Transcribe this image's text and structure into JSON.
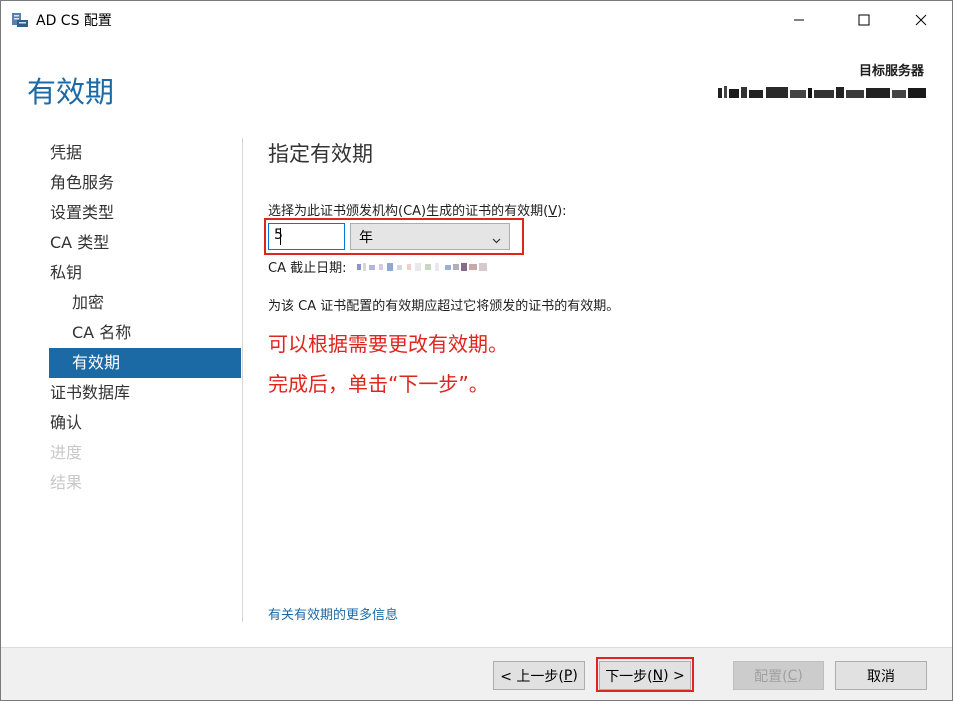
{
  "window": {
    "title": "AD CS 配置",
    "controls": {
      "minimize": "minimize-icon",
      "maximize": "maximize-icon",
      "close": "close-icon"
    }
  },
  "header": {
    "page_title": "有效期",
    "target_server_label": "目标服务器"
  },
  "nav": {
    "items": [
      {
        "label": "凭据",
        "state": "normal",
        "level": 0
      },
      {
        "label": "角色服务",
        "state": "normal",
        "level": 0
      },
      {
        "label": "设置类型",
        "state": "normal",
        "level": 0
      },
      {
        "label": "CA 类型",
        "state": "normal",
        "level": 0
      },
      {
        "label": "私钥",
        "state": "normal",
        "level": 0
      },
      {
        "label": "加密",
        "state": "normal",
        "level": 1
      },
      {
        "label": "CA 名称",
        "state": "normal",
        "level": 1
      },
      {
        "label": "有效期",
        "state": "active",
        "level": 1
      },
      {
        "label": "证书数据库",
        "state": "normal",
        "level": 0
      },
      {
        "label": "确认",
        "state": "normal",
        "level": 0
      },
      {
        "label": "进度",
        "state": "disabled",
        "level": 0
      },
      {
        "label": "结果",
        "state": "disabled",
        "level": 0
      }
    ]
  },
  "main": {
    "section_title": "指定有效期",
    "select_label_prefix": "选择为此证书颁发机构(CA)生成的证书的有效期(",
    "select_label_key": "V",
    "select_label_suffix": "):",
    "period_value": "5",
    "unit_value": "年",
    "ca_expiry_label": "CA 截止日期:",
    "description": "为该 CA 证书配置的有效期应超过它将颁发的证书的有效期。",
    "annotation_line1": "可以根据需要更改有效期。",
    "annotation_line2": "完成后，单击“下一步”。",
    "more_info_link": "有关有效期的更多信息"
  },
  "footer": {
    "back_prefix": "< 上一步(",
    "back_key": "P",
    "back_suffix": ")",
    "next_prefix": "下一步(",
    "next_key": "N",
    "next_suffix": ") >",
    "configure_prefix": "配置(",
    "configure_key": "C",
    "configure_suffix": ")",
    "cancel_label": "取消"
  },
  "colors": {
    "accent": "#1b6aa5",
    "annotation_red": "#e1241c",
    "disabled_text": "#c8c8c8"
  }
}
